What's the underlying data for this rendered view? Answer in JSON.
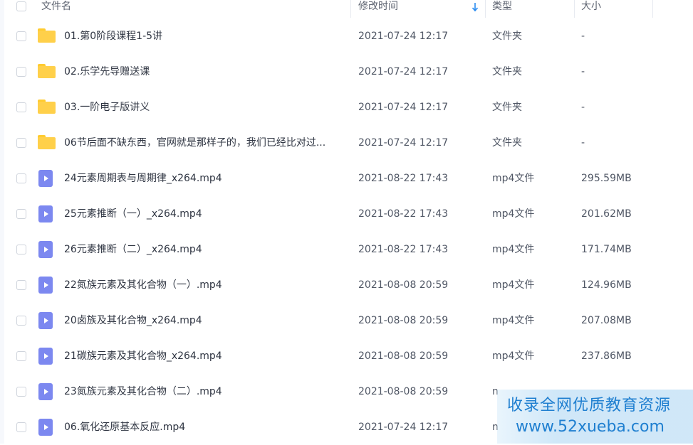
{
  "header": {
    "name_label": "文件名",
    "time_label": "修改时间",
    "type_label": "类型",
    "size_label": "大小"
  },
  "files": [
    {
      "name": "01.第0阶段课程1-5讲",
      "time": "2021-07-24 12:17",
      "type": "文件夹",
      "size": "-",
      "icon": "folder-icon"
    },
    {
      "name": "02.乐学先导赠送课",
      "time": "2021-07-24 12:17",
      "type": "文件夹",
      "size": "-",
      "icon": "folder-icon"
    },
    {
      "name": "03.一阶电子版讲义",
      "time": "2021-07-24 12:17",
      "type": "文件夹",
      "size": "-",
      "icon": "folder-icon"
    },
    {
      "name": "06节后面不缺东西，官网就是那样子的，我们已经比对过...",
      "time": "2021-07-24 12:17",
      "type": "文件夹",
      "size": "-",
      "icon": "folder-icon"
    },
    {
      "name": "24元素周期表与周期律_x264.mp4",
      "time": "2021-08-22 17:43",
      "type": "mp4文件",
      "size": "295.59MB",
      "icon": "video-file-icon"
    },
    {
      "name": "25元素推断（一）_x264.mp4",
      "time": "2021-08-22 17:43",
      "type": "mp4文件",
      "size": "201.62MB",
      "icon": "video-file-icon"
    },
    {
      "name": "26元素推断（二）_x264.mp4",
      "time": "2021-08-22 17:43",
      "type": "mp4文件",
      "size": "171.74MB",
      "icon": "video-file-icon"
    },
    {
      "name": "22氮族元素及其化合物（一）.mp4",
      "time": "2021-08-08 20:59",
      "type": "mp4文件",
      "size": "124.96MB",
      "icon": "video-file-icon"
    },
    {
      "name": "20卤族及其化合物_x264.mp4",
      "time": "2021-08-08 20:59",
      "type": "mp4文件",
      "size": "207.08MB",
      "icon": "video-file-icon"
    },
    {
      "name": "21碳族元素及其化合物_x264.mp4",
      "time": "2021-08-08 20:59",
      "type": "mp4文件",
      "size": "237.86MB",
      "icon": "video-file-icon"
    },
    {
      "name": "23氮族元素及其化合物（二）.mp4",
      "time": "2021-08-08 20:59",
      "type": "n",
      "size": "",
      "icon": "video-file-icon"
    },
    {
      "name": "06.氧化还原基本反应.mp4",
      "time": "2021-07-24 12:17",
      "type": "n",
      "size": "",
      "icon": "video-file-icon"
    }
  ],
  "watermark": {
    "line1": "收录全网优质教育资源",
    "line2": "www.52xueba.com"
  },
  "colors": {
    "folder": "#ffd04a",
    "video": "#7c88f0",
    "accent": "#2a8cf0",
    "watermark_text": "#1f7fd0"
  }
}
